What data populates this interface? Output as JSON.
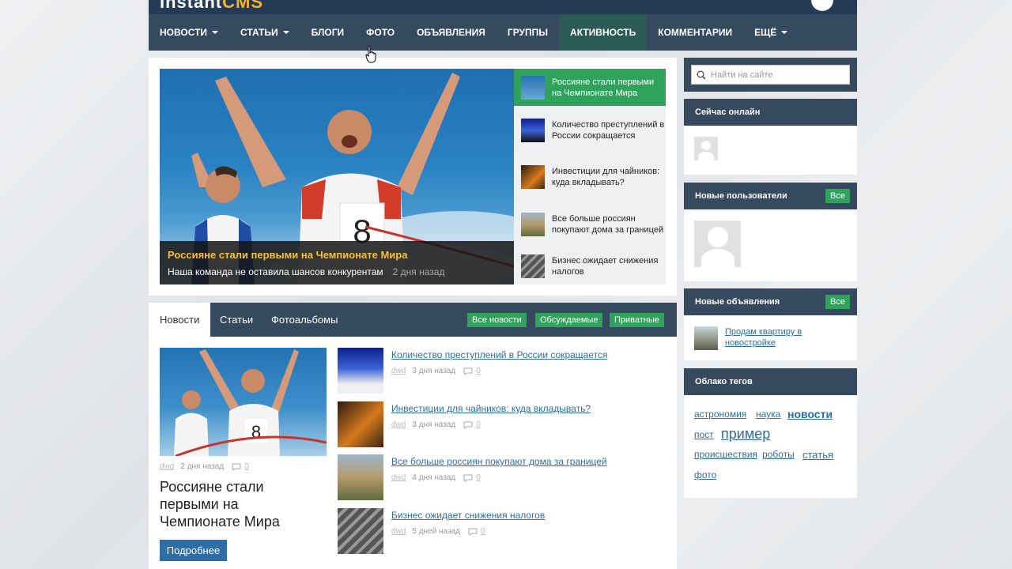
{
  "site": {
    "logo_main": "Instant",
    "logo_accent": "CMS"
  },
  "nav": {
    "items": [
      {
        "label": "НОВОСТИ",
        "dropdown": true
      },
      {
        "label": "СТАТЬИ",
        "dropdown": true
      },
      {
        "label": "БЛОГИ",
        "dropdown": false
      },
      {
        "label": "ФОТО",
        "dropdown": false
      },
      {
        "label": "ОБЪЯВЛЕНИЯ",
        "dropdown": false
      },
      {
        "label": "ГРУППЫ",
        "dropdown": false
      },
      {
        "label": "АКТИВНОСТЬ",
        "dropdown": false,
        "active": true
      },
      {
        "label": "КОММЕНТАРИИ",
        "dropdown": false
      },
      {
        "label": "ЕЩЁ",
        "dropdown": true
      }
    ]
  },
  "slider": {
    "main": {
      "title": "Россияне стали первыми на Чемпионате Мира",
      "subtitle": "Наша команда не оставила шансов конкурентам",
      "date": "2 дня назад"
    },
    "items": [
      {
        "title": "Россияне стали первыми на Чемпионате Мира",
        "active": true
      },
      {
        "title": "Количество преступлений в России сокращается"
      },
      {
        "title": "Инвестиции для чайников: куда вкладывать?"
      },
      {
        "title": "Все больше россиян покупают дома за границей"
      },
      {
        "title": "Бизнес ожидает снижения налогов"
      }
    ]
  },
  "content": {
    "tabs": [
      "Новости",
      "Статьи",
      "Фотоальбомы"
    ],
    "buttons": [
      "Все новости",
      "Обсуждаемые",
      "Приватные"
    ],
    "featured": {
      "author": "dwd",
      "date": "2 дня назад",
      "comments": "0",
      "title": "Россияне стали первыми на Чемпионате Мира",
      "more_label": "Подробнее"
    },
    "news": [
      {
        "title": "Количество преступлений в России сокращается",
        "author": "dwd",
        "date": "3 дня назад",
        "comments": "0"
      },
      {
        "title": "Инвестиции для чайников: куда вкладывать?",
        "author": "dwd",
        "date": "3 дня назад",
        "comments": "0"
      },
      {
        "title": "Все больше россиян покупают дома за границей",
        "author": "dwd",
        "date": "4 дня назад",
        "comments": "0"
      },
      {
        "title": "Бизнес ожидает снижения налогов",
        "author": "dwd",
        "date": "5 дней назад",
        "comments": "0"
      }
    ]
  },
  "sidebar": {
    "search_placeholder": "Найти на сайте",
    "online": {
      "title": "Сейчас онлайн"
    },
    "new_users": {
      "title": "Новые пользователи",
      "button": "Все"
    },
    "new_ads": {
      "title": "Новые объявления",
      "button": "Все",
      "item": "Продам квартиру в новостройке"
    },
    "tags": {
      "title": "Облако тегов",
      "items": [
        "астрономия",
        "наука",
        "новости",
        "пост",
        "пример",
        "происшествия",
        "роботы",
        "статья",
        "фото"
      ]
    }
  },
  "colors": {
    "header": "#35495f",
    "accent_green": "#2fa35c",
    "link_blue": "#2c6ea5",
    "slider_title": "#f5c033"
  }
}
